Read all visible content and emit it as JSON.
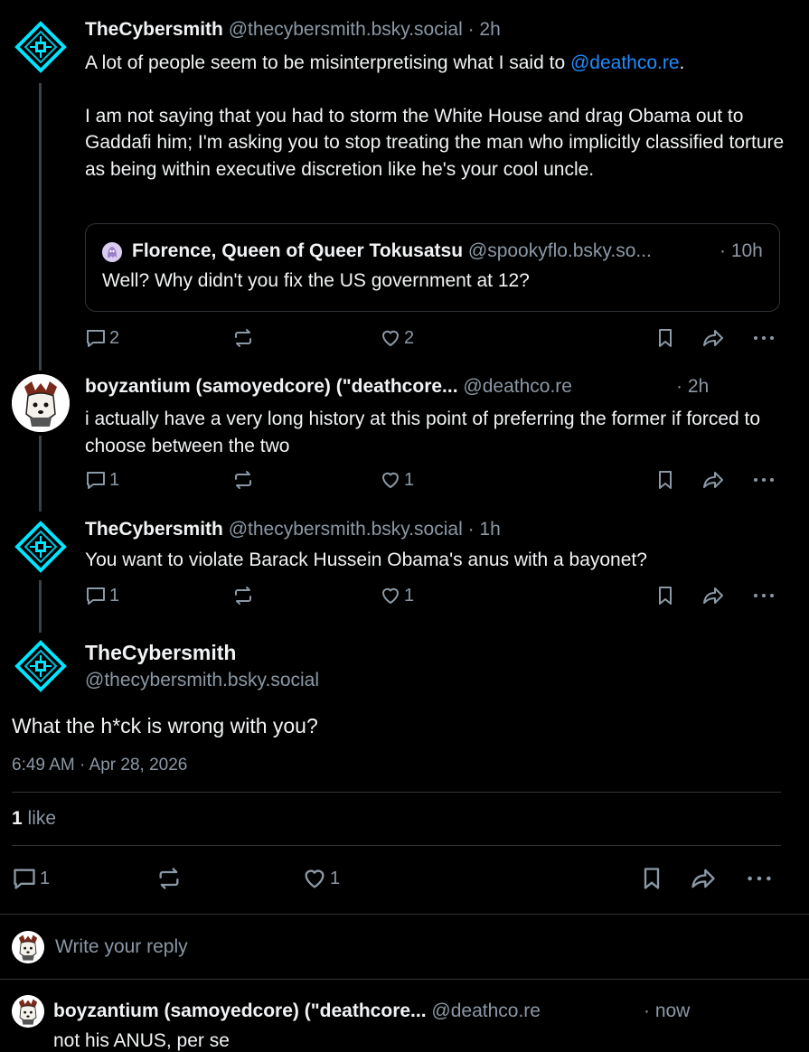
{
  "posts": [
    {
      "name": "TheCybersmith",
      "handle": "@thecybersmith.bsky.social",
      "time": "· 2h",
      "text_before": "A lot of people seem to be misinterpretising what I said to ",
      "mention": "@deathco.re",
      "text_after": ".",
      "text_p2": "I am not saying that you had to storm the White House and drag Obama out to Gaddafi him; I'm asking you to stop treating the man who implicitly classified torture as being within executive discretion like he's your cool uncle.",
      "quote": {
        "name": "Florence, Queen of Queer Tokusatsu",
        "handle": "@spookyflo.bsky.so...",
        "time": "· 10h",
        "text": "Well? Why didn't you fix the US government at 12?"
      },
      "replies": "2",
      "likes": "2"
    },
    {
      "name": "boyzantium (samoyedcore) (\"deathcore...",
      "handle": "@deathco.re",
      "time": "· 2h",
      "text": "i actually have a very long history at this point of preferring the former if forced to choose between the two",
      "replies": "1",
      "likes": "1"
    },
    {
      "name": "TheCybersmith",
      "handle": "@thecybersmith.bsky.social",
      "time": "· 1h",
      "text": "You want to violate Barack Hussein Obama's anus with a bayonet?",
      "replies": "1",
      "likes": "1"
    }
  ],
  "focused": {
    "name": "TheCybersmith",
    "handle": "@thecybersmith.bsky.social",
    "text": "What the h*ck is wrong with you?",
    "timestamp": "6:49 AM · Apr 28, 2026",
    "like_count": "1",
    "like_word": "like",
    "replies": "1",
    "likes": "1"
  },
  "reply_box": {
    "placeholder": "Write your reply"
  },
  "bottom_reply": {
    "name": "boyzantium (samoyedcore) (\"deathcore...",
    "handle": "@deathco.re",
    "time": "· now",
    "text": "not his ANUS, per se"
  },
  "colors": {
    "background": "#000000",
    "text": "#f1f3f5",
    "muted": "#8b98a5",
    "link": "#208bfe",
    "cyan_logo": "#00e5ff"
  }
}
